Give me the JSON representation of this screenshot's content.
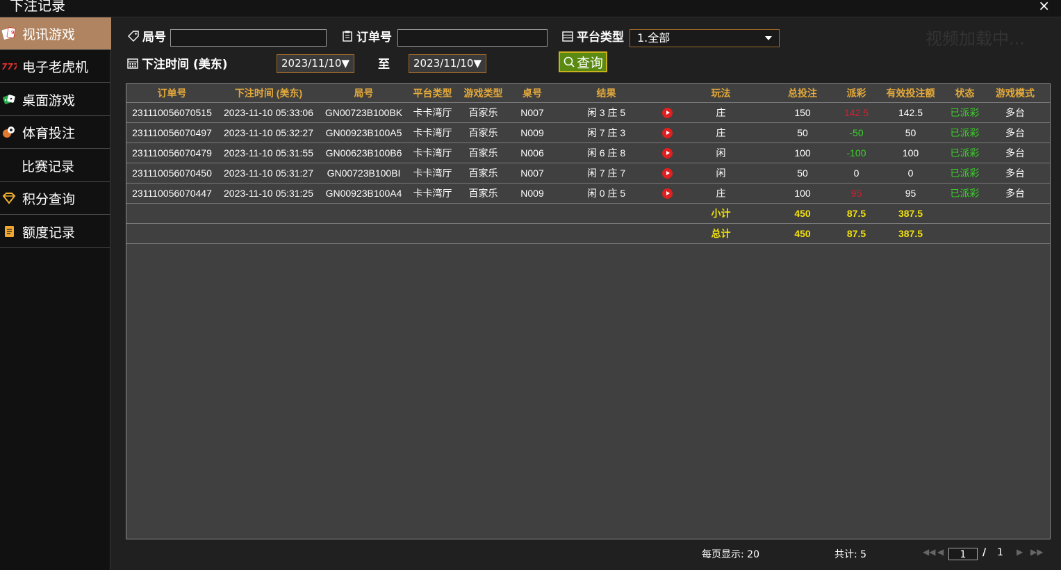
{
  "window": {
    "title": "下注记录",
    "close_glyph": "×"
  },
  "sidebar": {
    "items": [
      {
        "label": "视讯游戏",
        "icon": "playing-cards-icon",
        "active": true
      },
      {
        "label": "电子老虎机",
        "icon": "slot-777-icon",
        "active": false
      },
      {
        "label": "桌面游戏",
        "icon": "dice-icon",
        "active": false
      },
      {
        "label": "体育投注",
        "icon": "balls-icon",
        "active": false
      },
      {
        "label": "比赛记录",
        "icon": "",
        "active": false
      },
      {
        "label": "积分查询",
        "icon": "diamond-icon",
        "active": false
      },
      {
        "label": "额度记录",
        "icon": "document-icon",
        "active": false
      }
    ]
  },
  "filters": {
    "round_label": "局号",
    "round_value": "",
    "order_label": "订单号",
    "order_value": "",
    "platform_label": "平台类型",
    "platform_selected": "1.全部",
    "time_label": "下注时间 (美东)",
    "date_from": "2023/11/10▼",
    "to_label": "至",
    "date_to": "2023/11/10▼",
    "search_label": "查询"
  },
  "background_text": "视频加载中...",
  "table": {
    "headers": [
      "订单号",
      "下注时间 (美东)",
      "局号",
      "平台类型",
      "游戏类型",
      "桌号",
      "结果",
      "",
      "玩法",
      "总投注",
      "派彩",
      "有效投注额",
      "状态",
      "游戏模式"
    ],
    "rows": [
      {
        "order": "231110056070515",
        "time": "2023-11-10 05:33:06",
        "round": "GN00723B100BK",
        "platform": "卡卡湾厅",
        "game": "百家乐",
        "table": "N007",
        "result": "闲 3 庄 5",
        "play": "庄",
        "bet": "150",
        "payout": "142.5",
        "payout_color": "red",
        "valid": "142.5",
        "status": "已派彩",
        "mode": "多台"
      },
      {
        "order": "231110056070497",
        "time": "2023-11-10 05:32:27",
        "round": "GN00923B100A5",
        "platform": "卡卡湾厅",
        "game": "百家乐",
        "table": "N009",
        "result": "闲 7 庄 3",
        "play": "庄",
        "bet": "50",
        "payout": "-50",
        "payout_color": "green",
        "valid": "50",
        "status": "已派彩",
        "mode": "多台"
      },
      {
        "order": "231110056070479",
        "time": "2023-11-10 05:31:55",
        "round": "GN00623B100B6",
        "platform": "卡卡湾厅",
        "game": "百家乐",
        "table": "N006",
        "result": "闲 6 庄 8",
        "play": "闲",
        "bet": "100",
        "payout": "-100",
        "payout_color": "green",
        "valid": "100",
        "status": "已派彩",
        "mode": "多台"
      },
      {
        "order": "231110056070450",
        "time": "2023-11-10 05:31:27",
        "round": "GN00723B100BI",
        "platform": "卡卡湾厅",
        "game": "百家乐",
        "table": "N007",
        "result": "闲 7 庄 7",
        "play": "闲",
        "bet": "50",
        "payout": "0",
        "payout_color": "white",
        "valid": "0",
        "status": "已派彩",
        "mode": "多台"
      },
      {
        "order": "231110056070447",
        "time": "2023-11-10 05:31:25",
        "round": "GN00923B100A4",
        "platform": "卡卡湾厅",
        "game": "百家乐",
        "table": "N009",
        "result": "闲 0 庄 5",
        "play": "庄",
        "bet": "100",
        "payout": "95",
        "payout_color": "red",
        "valid": "95",
        "status": "已派彩",
        "mode": "多台"
      }
    ],
    "subtotal": {
      "label": "小计",
      "bet": "450",
      "payout": "87.5",
      "valid": "387.5"
    },
    "total": {
      "label": "总计",
      "bet": "450",
      "payout": "87.5",
      "valid": "387.5"
    }
  },
  "colors": {
    "accent": "#b08460",
    "header_text": "#e3a93a",
    "sum_text": "#f1e10c",
    "status_text": "#3bd02b",
    "loss_text": "#d02030",
    "search_button": "#5a8a12"
  },
  "pager": {
    "page_size_text": "每页显示: 20",
    "total_text": "共计: 5",
    "current_page": "1",
    "separator": "/",
    "total_pages": "1"
  }
}
